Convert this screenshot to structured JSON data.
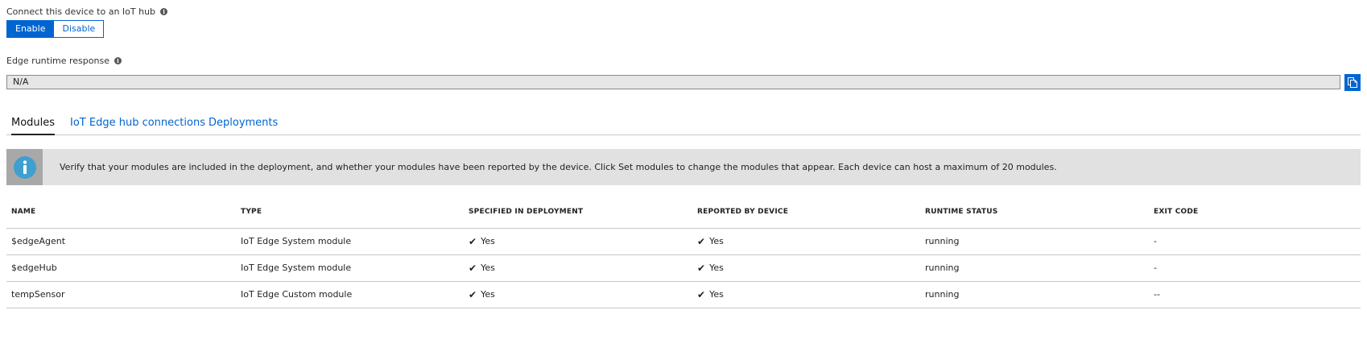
{
  "connect": {
    "label": "Connect this device to an IoT hub",
    "enable_label": "Enable",
    "disable_label": "Disable",
    "selected": "Enable"
  },
  "runtime": {
    "label": "Edge runtime response",
    "value": "N/A"
  },
  "tabs": [
    {
      "label": "Modules",
      "active": true
    },
    {
      "label": "IoT Edge hub connections",
      "active": false
    },
    {
      "label": "Deployments",
      "active": false
    }
  ],
  "banner": {
    "icon": "info-icon",
    "text": "Verify that your modules are included in the deployment, and whether your modules have been reported by the device. Click Set modules to change the modules that appear. Each device can host a maximum of 20 modules."
  },
  "table": {
    "headers": [
      "NAME",
      "TYPE",
      "SPECIFIED IN DEPLOYMENT",
      "REPORTED BY DEVICE",
      "RUNTIME STATUS",
      "EXIT CODE"
    ],
    "rows": [
      {
        "name": "$edgeAgent",
        "type": "IoT Edge System module",
        "specified": "Yes",
        "reported": "Yes",
        "status": "running",
        "exit": "-"
      },
      {
        "name": "$edgeHub",
        "type": "IoT Edge System module",
        "specified": "Yes",
        "reported": "Yes",
        "status": "running",
        "exit": "-"
      },
      {
        "name": "tempSensor",
        "type": "IoT Edge Custom module",
        "specified": "Yes",
        "reported": "Yes",
        "status": "running",
        "exit": "--"
      }
    ]
  },
  "colors": {
    "accent": "#0065d1",
    "banner_bg": "#e1e1e1",
    "info_icon": "#3f9fd1"
  }
}
